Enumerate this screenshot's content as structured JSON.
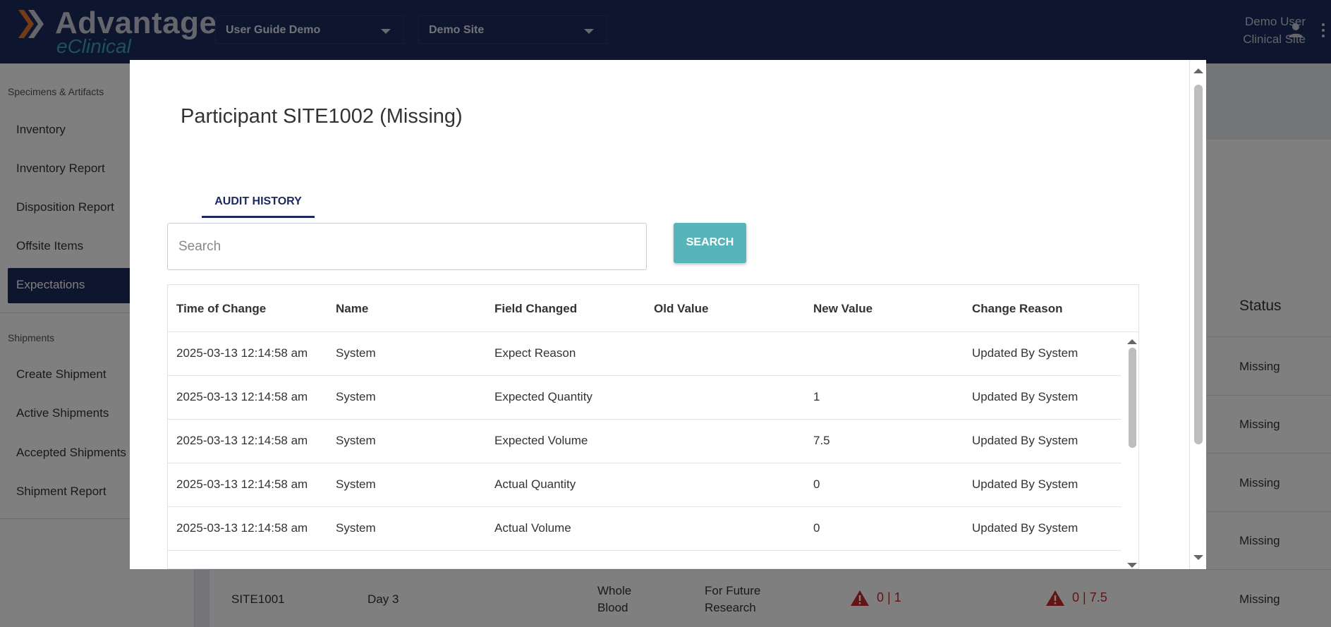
{
  "header": {
    "brand": "Advantage",
    "brand_sub": "eClinical",
    "study_select": "User Guide Demo",
    "site_select": "Demo Site",
    "user_name": "Demo User",
    "user_site": "Clinical Site"
  },
  "sidebar": {
    "section1": "Specimens & Artifacts",
    "items1": [
      "Inventory",
      "Inventory Report",
      "Disposition Report",
      "Offsite Items",
      "Expectations"
    ],
    "active": "Expectations",
    "section2": "Shipments",
    "items2": [
      "Create Shipment",
      "Active Shipments",
      "Accepted Shipments",
      "Shipment Report"
    ]
  },
  "background": {
    "status_header": "Status",
    "statuses": [
      "Missing",
      "Missing",
      "Missing",
      "Missing",
      "Missing"
    ],
    "last_row": {
      "participant": "SITE1001",
      "visit": "Day 3",
      "type": "Whole Blood",
      "purpose": "For Future Research",
      "quantity": "0 | 1",
      "volume": "0 | 7.5"
    }
  },
  "modal": {
    "title": "Participant SITE1002 (Missing)",
    "tab": "AUDIT HISTORY",
    "search_placeholder": "Search",
    "search_button": "SEARCH",
    "columns": [
      "Time of Change",
      "Name",
      "Field Changed",
      "Old Value",
      "New Value",
      "Change Reason"
    ],
    "rows": [
      [
        "2025-03-13 12:14:58 am",
        "System",
        "Expect Reason",
        "",
        "",
        "Updated By System"
      ],
      [
        "2025-03-13 12:14:58 am",
        "System",
        "Expected Quantity",
        "",
        "1",
        "Updated By System"
      ],
      [
        "2025-03-13 12:14:58 am",
        "System",
        "Expected Volume",
        "",
        "7.5",
        "Updated By System"
      ],
      [
        "2025-03-13 12:14:58 am",
        "System",
        "Actual Quantity",
        "",
        "0",
        "Updated By System"
      ],
      [
        "2025-03-13 12:14:58 am",
        "System",
        "Actual Volume",
        "",
        "0",
        "Updated By System"
      ]
    ]
  },
  "colors": {
    "navy": "#1b2a5e",
    "teal": "#56b4bb",
    "warning": "#c62828"
  },
  "icons": {
    "logo": "chevron-logo-icon",
    "user": "person-icon",
    "menu": "kebab-menu-icon",
    "warning": "warning-triangle-icon"
  }
}
